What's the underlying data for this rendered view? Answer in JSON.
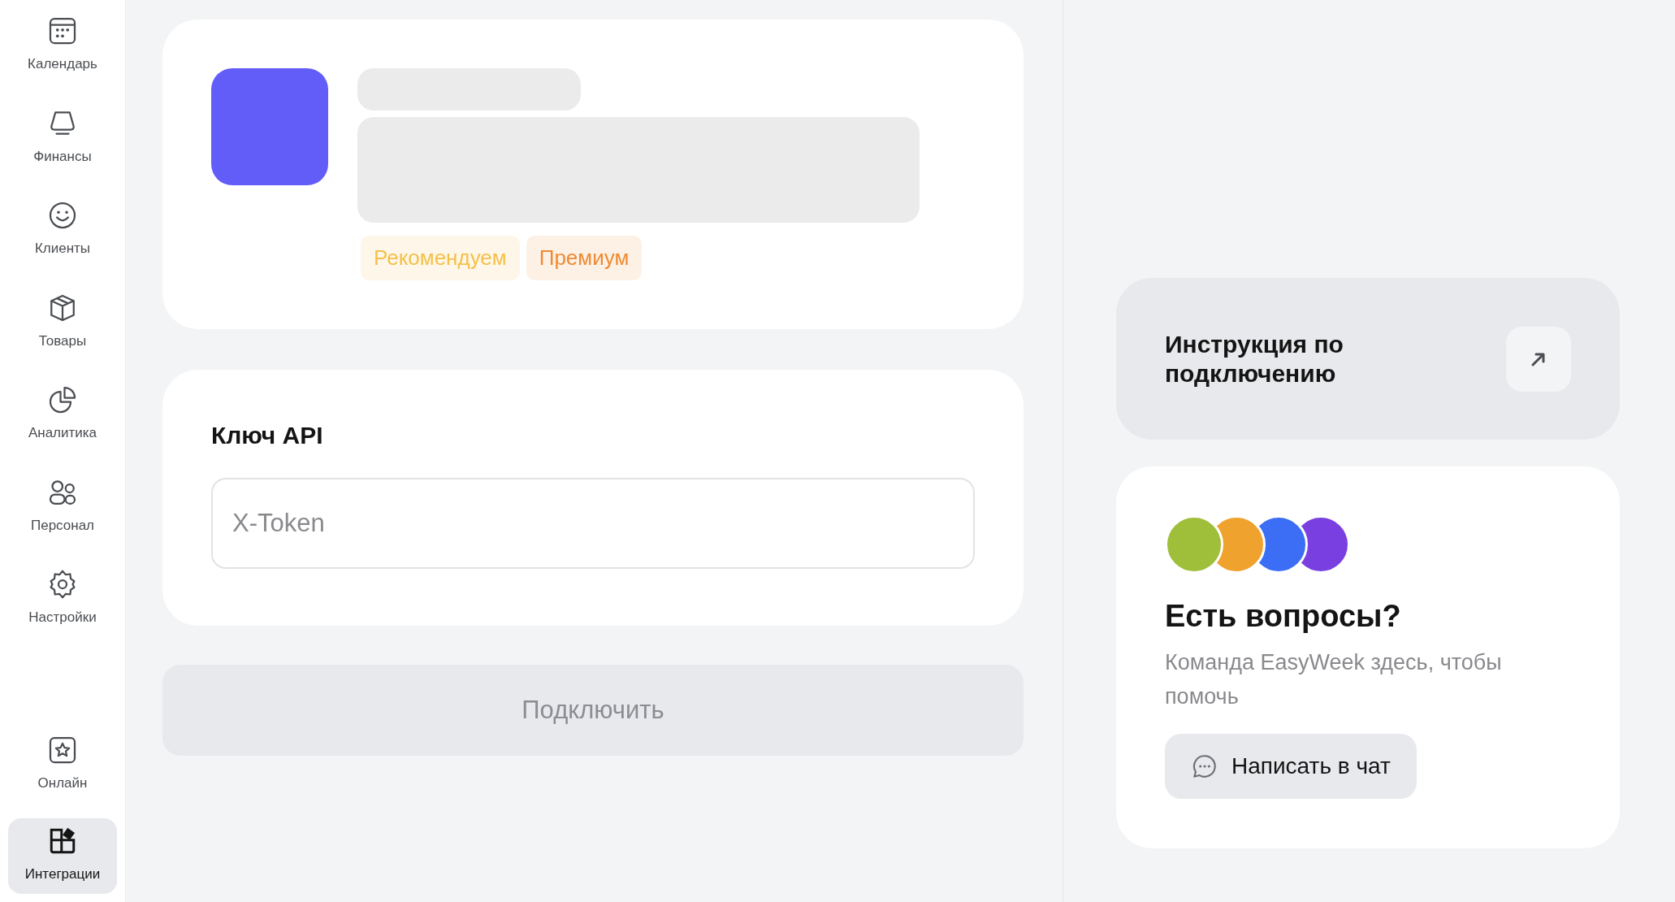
{
  "sidebar": {
    "items": [
      {
        "label": "Календарь",
        "selected": false
      },
      {
        "label": "Финансы",
        "selected": false
      },
      {
        "label": "Клиенты",
        "selected": false
      },
      {
        "label": "Товары",
        "selected": false
      },
      {
        "label": "Аналитика",
        "selected": false
      },
      {
        "label": "Персонал",
        "selected": false
      },
      {
        "label": "Настройки",
        "selected": false
      }
    ],
    "bottom_items": [
      {
        "label": "Онлайн",
        "selected": false
      },
      {
        "label": "Интеграции",
        "selected": true
      }
    ]
  },
  "integration_card": {
    "tags": [
      {
        "label": "Рекомендуем",
        "color": "#f5c04a"
      },
      {
        "label": "Премиум",
        "color": "#ef8a32"
      }
    ]
  },
  "api_card": {
    "title": "Ключ API",
    "field": {
      "placeholder": "X-Token"
    }
  },
  "connect_button": {
    "label": "Подключить",
    "disabled": true
  },
  "guide_card": {
    "title": "Инструкция по подключению"
  },
  "help_card": {
    "avatars": [
      {
        "color": "#9fbf3b"
      },
      {
        "color": "#f0a22e"
      },
      {
        "color": "#3b6ef5"
      },
      {
        "color": "#7a3fe0"
      }
    ],
    "title": "Есть вопросы?",
    "text": "Команда EasyWeek здесь, чтобы помочь",
    "button": "Написать в чат"
  }
}
